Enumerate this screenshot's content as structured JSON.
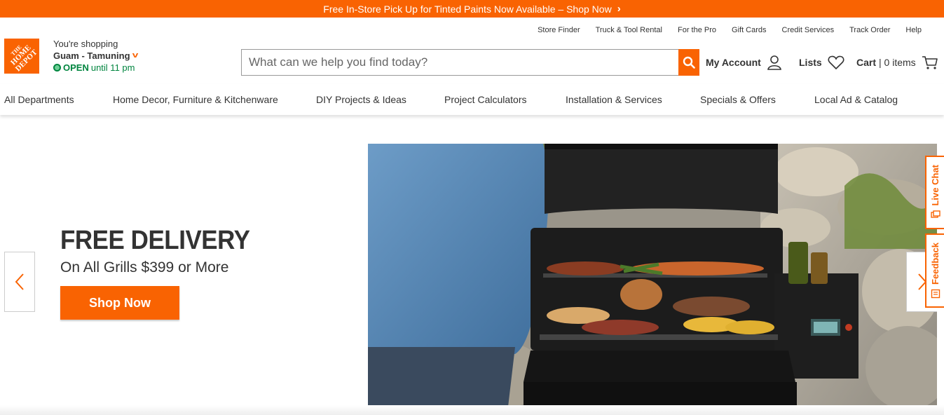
{
  "promo": {
    "text": "Free In-Store Pick Up for Tinted Paints Now Available – Shop Now"
  },
  "utility_nav": [
    "Store Finder",
    "Truck & Tool Rental",
    "For the Pro",
    "Gift Cards",
    "Credit Services",
    "Track Order",
    "Help"
  ],
  "logo": {
    "line1": "THE",
    "line2": "HOME",
    "line3": "DEPOT"
  },
  "store": {
    "shopping_label": "You're shopping",
    "name": "Guam - Tamuning",
    "status": "OPEN",
    "hours": "until 11 pm"
  },
  "search": {
    "placeholder": "What can we help you find today?"
  },
  "header": {
    "account_label": "My Account",
    "lists_label": "Lists",
    "cart_label": "Cart",
    "cart_count": "| 0 items"
  },
  "main_nav": [
    "All Departments",
    "Home Decor, Furniture & Kitchenware",
    "DIY Projects & Ideas",
    "Project Calculators",
    "Installation & Services",
    "Specials & Offers",
    "Local Ad & Catalog"
  ],
  "hero": {
    "title": "FREE DELIVERY",
    "subtitle": "On All Grills $399 or More",
    "cta": "Shop Now"
  },
  "side_tabs": {
    "chat": "Live Chat",
    "feedback": "Feedback"
  },
  "colors": {
    "brand": "#f96302",
    "open_green": "#00853f"
  }
}
